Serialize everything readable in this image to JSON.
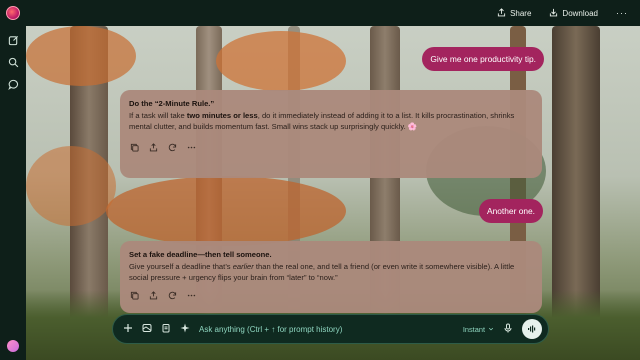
{
  "topbar": {
    "share_label": "Share",
    "download_label": "Download",
    "more_label": "···"
  },
  "messages": {
    "user1": "Give me one productivity tip.",
    "reply1": {
      "title": "Do the “2-Minute Rule.”",
      "pre": "If a task will take ",
      "bold": "two minutes or less",
      "post": ", do it immediately instead of adding it to a list. It kills procrastination, shrinks mental clutter, and builds momentum fast. Small wins stack up surprisingly quickly. 🌸"
    },
    "user2": "Another one.",
    "reply2": {
      "title": "Set a fake deadline—then tell someone.",
      "pre": "Give yourself a deadline that’s ",
      "italic": "earlier",
      "post": " than the real one, and tell a friend (or even write it somewhere visible). A little social pressure + urgency flips your brain from “later” to “now.”"
    }
  },
  "composer": {
    "placeholder": "Ask anything (Ctrl + ↑ for prompt history)",
    "mode": "Instant"
  },
  "icons": [
    "app-logo-icon",
    "new-chat-icon",
    "search-icon",
    "chat-icon",
    "share-icon",
    "download-icon",
    "copy-icon",
    "export-icon",
    "regenerate-icon",
    "more-icon",
    "plus-icon",
    "image-icon",
    "clipboard-icon",
    "sparkle-icon",
    "chevron-down-icon",
    "mic-icon",
    "voice-mode-icon"
  ],
  "colors": {
    "user_bubble": "#a3245e",
    "reply_card": "#ab897c",
    "app_bg": "#0e1f19"
  }
}
